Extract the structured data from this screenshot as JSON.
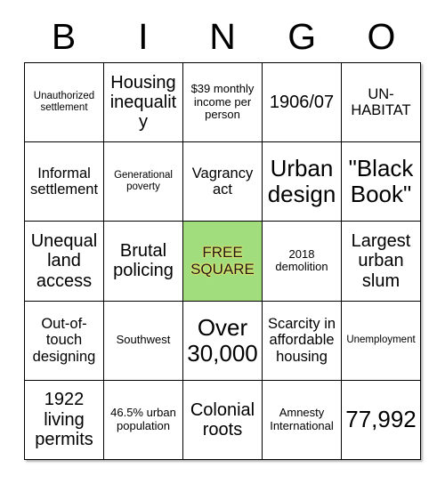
{
  "card": {
    "title_letters": [
      "B",
      "I",
      "N",
      "G",
      "O"
    ],
    "free_square_color": "#a2dd7d",
    "border_color": "#000000",
    "rows": [
      [
        {
          "text": "Unauthorized settlement",
          "size": "xs",
          "free": false
        },
        {
          "text": "Housing inequality",
          "size": "lg",
          "free": false
        },
        {
          "text": "$39 monthly income per person",
          "size": "sm",
          "free": false
        },
        {
          "text": "1906/07",
          "size": "lg",
          "free": false
        },
        {
          "text": "UN-HABITAT",
          "size": "md",
          "free": false
        }
      ],
      [
        {
          "text": "Informal settlement",
          "size": "md",
          "free": false
        },
        {
          "text": "Generational poverty",
          "size": "xs",
          "free": false
        },
        {
          "text": "Vagrancy act",
          "size": "md",
          "free": false
        },
        {
          "text": "Urban design",
          "size": "xxl",
          "free": false
        },
        {
          "text": "\"Black Book\"",
          "size": "xxl",
          "free": false
        }
      ],
      [
        {
          "text": "Unequal land access",
          "size": "lg",
          "free": false
        },
        {
          "text": "Brutal policing",
          "size": "lg",
          "free": false
        },
        {
          "text": "FREE SQUARE",
          "size": "md",
          "free": true
        },
        {
          "text": "2018 demolition",
          "size": "sm",
          "free": false
        },
        {
          "text": "Largest urban slum",
          "size": "lg",
          "free": false
        }
      ],
      [
        {
          "text": "Out-of-touch designing",
          "size": "md",
          "free": false
        },
        {
          "text": "Southwest",
          "size": "sm",
          "free": false
        },
        {
          "text": "Over 30,000",
          "size": "xxl",
          "free": false
        },
        {
          "text": "Scarcity in affordable housing",
          "size": "md",
          "free": false
        },
        {
          "text": "Unemployment",
          "size": "xs",
          "free": false
        }
      ],
      [
        {
          "text": "1922 living permits",
          "size": "lg",
          "free": false
        },
        {
          "text": "46.5% urban population",
          "size": "sm",
          "free": false
        },
        {
          "text": "Colonial roots",
          "size": "lg",
          "free": false
        },
        {
          "text": "Amnesty International",
          "size": "sm",
          "free": false
        },
        {
          "text": "77,992",
          "size": "xxl",
          "free": false
        }
      ]
    ]
  }
}
